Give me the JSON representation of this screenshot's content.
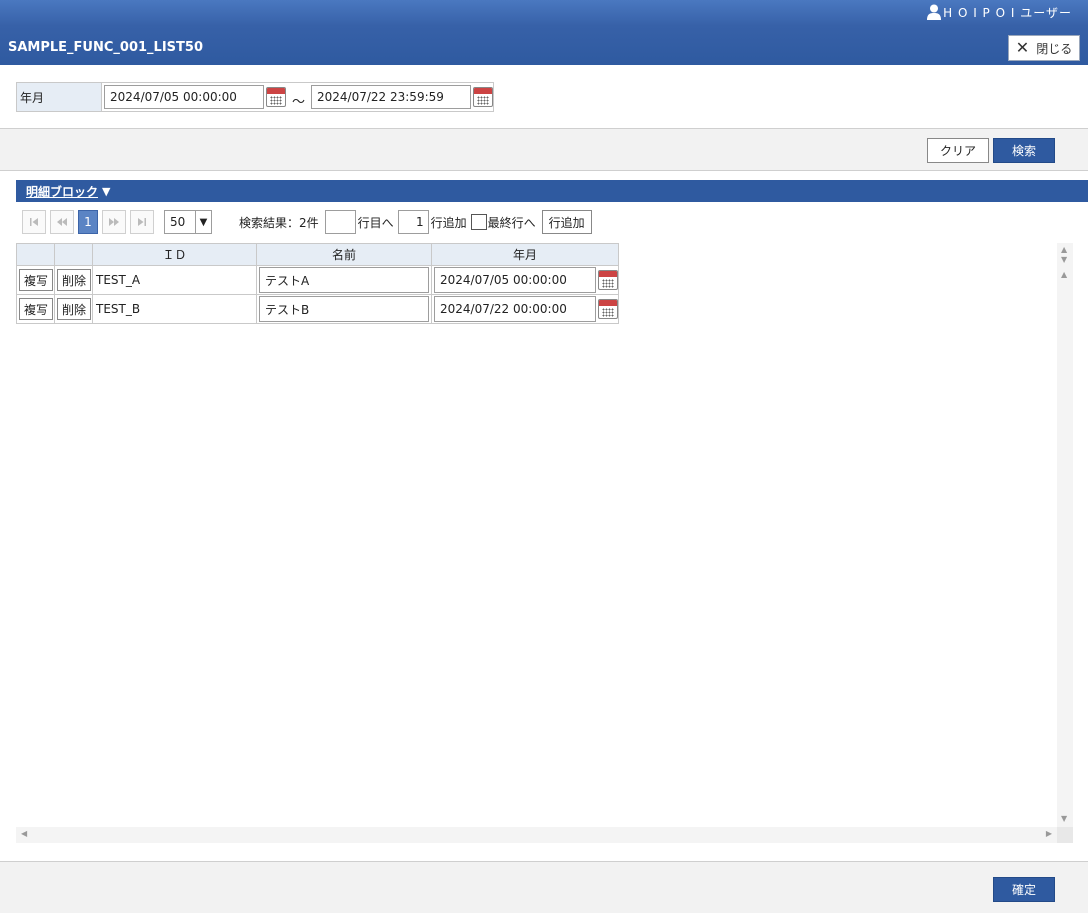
{
  "header": {
    "user_name": "H O I P O I ユーザー",
    "title": "SAMPLE_FUNC_001_LIST50",
    "close_label": "閉じる"
  },
  "search": {
    "label": "年月",
    "from_value": "2024/07/05 00:00:00",
    "to_value": "2024/07/22 23:59:59",
    "separator": "～"
  },
  "buttons": {
    "clear": "クリア",
    "search": "検索",
    "confirm": "確定"
  },
  "block": {
    "title": "明細ブロック",
    "toggle": "▼"
  },
  "pager": {
    "first": "⏮",
    "prev": "⏪",
    "current_page": "1",
    "next": "⏩",
    "last": "⏭",
    "page_size": "50",
    "result_text": "検索結果：2件",
    "goto_row_value": "",
    "goto_row_label": "行目へ",
    "add_count_value": "1",
    "add_label": "行追加",
    "last_row_label": "最終行へ",
    "add_button": "行追加"
  },
  "table": {
    "headers": [
      "",
      "",
      "ＩＤ",
      "名前",
      "年月"
    ],
    "copy_label": "複写",
    "delete_label": "削除",
    "rows": [
      {
        "id": "TEST_A",
        "name": "テストA",
        "date": "2024/07/05 00:00:00"
      },
      {
        "id": "TEST_B",
        "name": "テストB",
        "date": "2024/07/22 00:00:00"
      }
    ]
  },
  "colors": {
    "header_blue": "#2f5aa0",
    "label_bg": "#e6edf5"
  }
}
